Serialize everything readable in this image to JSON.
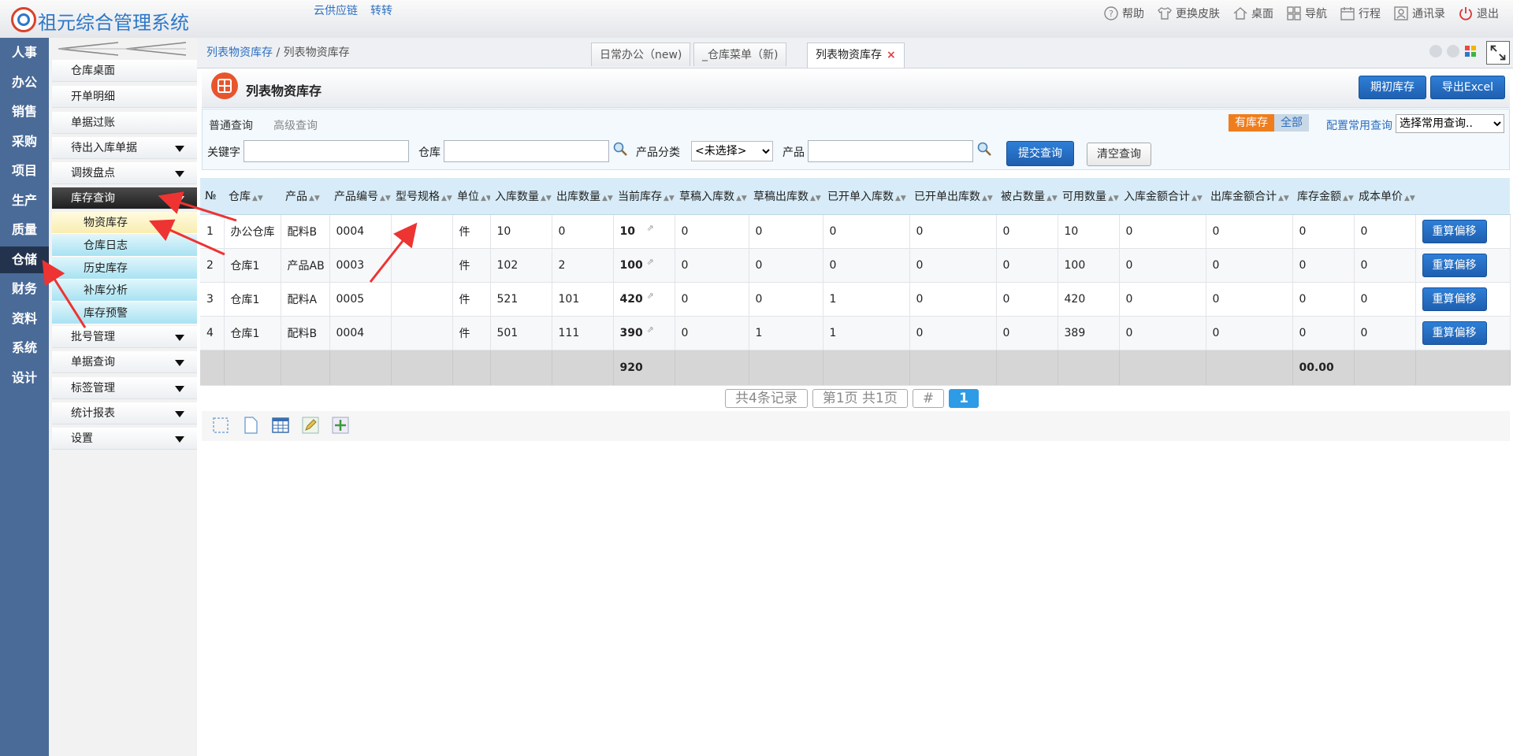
{
  "app": {
    "title": "祖元综合管理系统",
    "links": [
      "云供应链",
      "转转"
    ]
  },
  "top_actions": [
    {
      "label": "帮助",
      "icon": "help-icon"
    },
    {
      "label": "更换皮肤",
      "icon": "shirt-icon"
    },
    {
      "label": "桌面",
      "icon": "home-icon"
    },
    {
      "label": "导航",
      "icon": "grid-icon"
    },
    {
      "label": "行程",
      "icon": "calendar-icon"
    },
    {
      "label": "通讯录",
      "icon": "contact-icon"
    },
    {
      "label": "退出",
      "icon": "power-icon"
    }
  ],
  "rail": [
    "人事",
    "办公",
    "销售",
    "采购",
    "项目",
    "生产",
    "质量",
    "仓储",
    "财务",
    "资料",
    "系统",
    "设计"
  ],
  "rail_active": "仓储",
  "submenu": {
    "items_top": [
      "仓库桌面",
      "开单明细",
      "单据过账",
      "待出入库单据",
      "调拨盘点",
      "库存查询"
    ],
    "children": [
      "物资库存",
      "仓库日志",
      "历史库存",
      "补库分析",
      "库存预警"
    ],
    "items_bottom": [
      "批号管理",
      "单据查询",
      "标签管理",
      "统计报表",
      "设置"
    ]
  },
  "breadcrumb": {
    "link": "列表物资库存",
    "sep": " / ",
    "current": "列表物资库存"
  },
  "tabs": [
    {
      "label": "日常办公（new)"
    },
    {
      "label": "_仓库菜单（新)"
    },
    {
      "label": "列表物资库存"
    }
  ],
  "tab_close": "×",
  "page": {
    "title": "列表物资库存",
    "buttons": [
      "期初库存",
      "导出Excel"
    ]
  },
  "query": {
    "tab_normal": "普通查询",
    "tab_adv": "高级查询",
    "toggle_on": "有库存",
    "toggle_off": "全部",
    "config_link": "配置常用查询",
    "common_select": "选择常用查询..",
    "keyword_label": "关键字",
    "keyword_value": "",
    "warehouse_label": "仓库",
    "warehouse_value": "",
    "category_label": "产品分类",
    "category_value": "<未选择>",
    "product_label": "产品",
    "product_value": "",
    "submit": "提交查询",
    "clear": "清空查询"
  },
  "table": {
    "headers": [
      "№",
      "仓库",
      "产品",
      "产品编号",
      "型号规格",
      "单位",
      "入库数量",
      "出库数量",
      "当前库存",
      "草稿入库数",
      "草稿出库数",
      "已开单入库数",
      "已开单出库数",
      "被占数量",
      "可用数量",
      "入库金额合计",
      "出库金额合计",
      "库存金额",
      "成本单价",
      ""
    ],
    "rows": [
      [
        "1",
        "办公仓库",
        "配料B",
        "0004",
        "",
        "件",
        "10",
        "0",
        "10",
        "0",
        "0",
        "0",
        "0",
        "0",
        "10",
        "0",
        "0",
        "0",
        "0"
      ],
      [
        "2",
        "仓库1",
        "产品AB",
        "0003",
        "",
        "件",
        "102",
        "2",
        "100",
        "0",
        "0",
        "0",
        "0",
        "0",
        "100",
        "0",
        "0",
        "0",
        "0"
      ],
      [
        "3",
        "仓库1",
        "配料A",
        "0005",
        "",
        "件",
        "521",
        "101",
        "420",
        "0",
        "0",
        "1",
        "0",
        "0",
        "420",
        "0",
        "0",
        "0",
        "0"
      ],
      [
        "4",
        "仓库1",
        "配料B",
        "0004",
        "",
        "件",
        "501",
        "111",
        "390",
        "0",
        "1",
        "1",
        "0",
        "0",
        "389",
        "0",
        "0",
        "0",
        "0"
      ]
    ],
    "row_button": "重算偏移",
    "summary": {
      "current_stock": "920",
      "stock_amount": "00.00"
    }
  },
  "pager": {
    "total": "共4条记录",
    "pages": "第1页 共1页",
    "hash": "#",
    "current": "1"
  },
  "colors": {
    "rail_bg": "#4a6b98",
    "accent_blue": "#1f5fb0",
    "orange": "#ef7d1d",
    "header_bg": "#d7ecf8"
  }
}
